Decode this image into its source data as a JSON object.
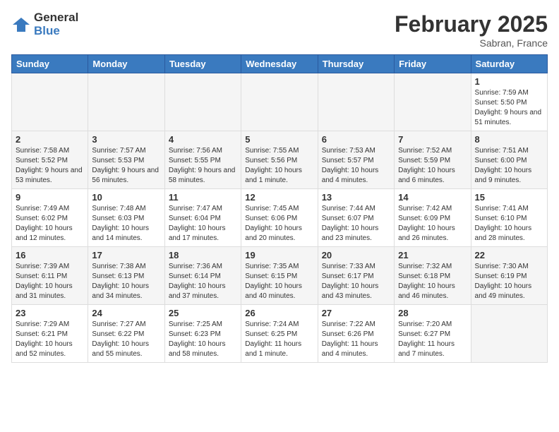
{
  "header": {
    "logo_general": "General",
    "logo_blue": "Blue",
    "month_title": "February 2025",
    "subtitle": "Sabran, France"
  },
  "days_of_week": [
    "Sunday",
    "Monday",
    "Tuesday",
    "Wednesday",
    "Thursday",
    "Friday",
    "Saturday"
  ],
  "weeks": [
    [
      {
        "day": "",
        "sunrise": "",
        "sunset": "",
        "daylight": ""
      },
      {
        "day": "",
        "sunrise": "",
        "sunset": "",
        "daylight": ""
      },
      {
        "day": "",
        "sunrise": "",
        "sunset": "",
        "daylight": ""
      },
      {
        "day": "",
        "sunrise": "",
        "sunset": "",
        "daylight": ""
      },
      {
        "day": "",
        "sunrise": "",
        "sunset": "",
        "daylight": ""
      },
      {
        "day": "",
        "sunrise": "",
        "sunset": "",
        "daylight": ""
      },
      {
        "day": "1",
        "sunrise": "7:59 AM",
        "sunset": "5:50 PM",
        "daylight": "9 hours and 51 minutes."
      }
    ],
    [
      {
        "day": "2",
        "sunrise": "7:58 AM",
        "sunset": "5:52 PM",
        "daylight": "9 hours and 53 minutes."
      },
      {
        "day": "3",
        "sunrise": "7:57 AM",
        "sunset": "5:53 PM",
        "daylight": "9 hours and 56 minutes."
      },
      {
        "day": "4",
        "sunrise": "7:56 AM",
        "sunset": "5:55 PM",
        "daylight": "9 hours and 58 minutes."
      },
      {
        "day": "5",
        "sunrise": "7:55 AM",
        "sunset": "5:56 PM",
        "daylight": "10 hours and 1 minute."
      },
      {
        "day": "6",
        "sunrise": "7:53 AM",
        "sunset": "5:57 PM",
        "daylight": "10 hours and 4 minutes."
      },
      {
        "day": "7",
        "sunrise": "7:52 AM",
        "sunset": "5:59 PM",
        "daylight": "10 hours and 6 minutes."
      },
      {
        "day": "8",
        "sunrise": "7:51 AM",
        "sunset": "6:00 PM",
        "daylight": "10 hours and 9 minutes."
      }
    ],
    [
      {
        "day": "9",
        "sunrise": "7:49 AM",
        "sunset": "6:02 PM",
        "daylight": "10 hours and 12 minutes."
      },
      {
        "day": "10",
        "sunrise": "7:48 AM",
        "sunset": "6:03 PM",
        "daylight": "10 hours and 14 minutes."
      },
      {
        "day": "11",
        "sunrise": "7:47 AM",
        "sunset": "6:04 PM",
        "daylight": "10 hours and 17 minutes."
      },
      {
        "day": "12",
        "sunrise": "7:45 AM",
        "sunset": "6:06 PM",
        "daylight": "10 hours and 20 minutes."
      },
      {
        "day": "13",
        "sunrise": "7:44 AM",
        "sunset": "6:07 PM",
        "daylight": "10 hours and 23 minutes."
      },
      {
        "day": "14",
        "sunrise": "7:42 AM",
        "sunset": "6:09 PM",
        "daylight": "10 hours and 26 minutes."
      },
      {
        "day": "15",
        "sunrise": "7:41 AM",
        "sunset": "6:10 PM",
        "daylight": "10 hours and 28 minutes."
      }
    ],
    [
      {
        "day": "16",
        "sunrise": "7:39 AM",
        "sunset": "6:11 PM",
        "daylight": "10 hours and 31 minutes."
      },
      {
        "day": "17",
        "sunrise": "7:38 AM",
        "sunset": "6:13 PM",
        "daylight": "10 hours and 34 minutes."
      },
      {
        "day": "18",
        "sunrise": "7:36 AM",
        "sunset": "6:14 PM",
        "daylight": "10 hours and 37 minutes."
      },
      {
        "day": "19",
        "sunrise": "7:35 AM",
        "sunset": "6:15 PM",
        "daylight": "10 hours and 40 minutes."
      },
      {
        "day": "20",
        "sunrise": "7:33 AM",
        "sunset": "6:17 PM",
        "daylight": "10 hours and 43 minutes."
      },
      {
        "day": "21",
        "sunrise": "7:32 AM",
        "sunset": "6:18 PM",
        "daylight": "10 hours and 46 minutes."
      },
      {
        "day": "22",
        "sunrise": "7:30 AM",
        "sunset": "6:19 PM",
        "daylight": "10 hours and 49 minutes."
      }
    ],
    [
      {
        "day": "23",
        "sunrise": "7:29 AM",
        "sunset": "6:21 PM",
        "daylight": "10 hours and 52 minutes."
      },
      {
        "day": "24",
        "sunrise": "7:27 AM",
        "sunset": "6:22 PM",
        "daylight": "10 hours and 55 minutes."
      },
      {
        "day": "25",
        "sunrise": "7:25 AM",
        "sunset": "6:23 PM",
        "daylight": "10 hours and 58 minutes."
      },
      {
        "day": "26",
        "sunrise": "7:24 AM",
        "sunset": "6:25 PM",
        "daylight": "11 hours and 1 minute."
      },
      {
        "day": "27",
        "sunrise": "7:22 AM",
        "sunset": "6:26 PM",
        "daylight": "11 hours and 4 minutes."
      },
      {
        "day": "28",
        "sunrise": "7:20 AM",
        "sunset": "6:27 PM",
        "daylight": "11 hours and 7 minutes."
      },
      {
        "day": "",
        "sunrise": "",
        "sunset": "",
        "daylight": ""
      }
    ]
  ]
}
